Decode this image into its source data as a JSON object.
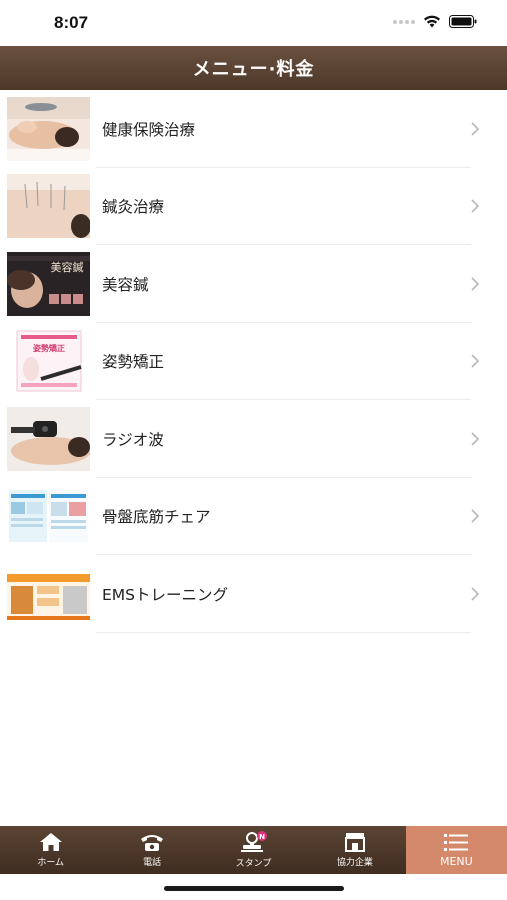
{
  "status_bar": {
    "time": "8:07"
  },
  "header": {
    "title": "メニュー·料金"
  },
  "menu": [
    {
      "label": "健康保険治療",
      "thumb_icon": "massage-photo"
    },
    {
      "label": "鍼灸治療",
      "thumb_icon": "acupuncture-photo"
    },
    {
      "label": "美容鍼",
      "thumb_icon": "beauty-acupuncture-flyer",
      "thumb_text": "美容鍼"
    },
    {
      "label": "姿勢矯正",
      "thumb_icon": "posture-correction-flyer",
      "thumb_text": "姿勢矯正"
    },
    {
      "label": "ラジオ波",
      "thumb_icon": "radio-wave-photo"
    },
    {
      "label": "骨盤底筋チェア",
      "thumb_icon": "pelvic-chair-brochure"
    },
    {
      "label": "EMSトレーニング",
      "thumb_icon": "ems-training-flyer"
    }
  ],
  "tabs": [
    {
      "label": "ホーム",
      "icon": "home-icon",
      "active": false
    },
    {
      "label": "電話",
      "icon": "phone-icon",
      "active": false
    },
    {
      "label": "スタンプ",
      "icon": "stamp-icon",
      "badge": "N",
      "active": false
    },
    {
      "label": "協力企業",
      "icon": "store-icon",
      "active": false
    },
    {
      "label": "MENU",
      "icon": "menu-icon",
      "active": true
    }
  ],
  "colors": {
    "header_brown": "#5c4434",
    "active_tab": "#d4896a",
    "badge_pink": "#e0307a"
  }
}
